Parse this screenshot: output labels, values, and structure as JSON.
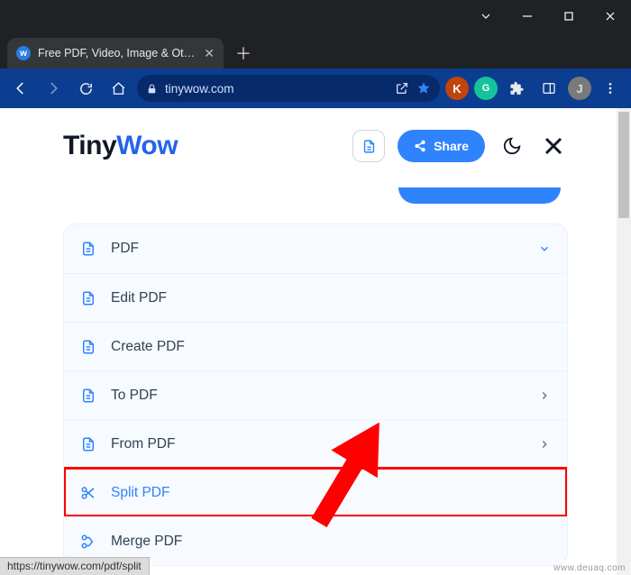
{
  "window": {
    "tab_title": "Free PDF, Video, Image & Other …"
  },
  "toolbar": {
    "url": "tinywow.com"
  },
  "header": {
    "logo_tiny": "Tiny",
    "logo_wow": "Wow",
    "share_label": "Share"
  },
  "menu": {
    "items": [
      {
        "label": "PDF",
        "icon": "file",
        "expandable": true,
        "expanded": true
      },
      {
        "label": "Edit PDF",
        "icon": "file"
      },
      {
        "label": "Create PDF",
        "icon": "file"
      },
      {
        "label": "To PDF",
        "icon": "file",
        "expandable": true
      },
      {
        "label": "From PDF",
        "icon": "file",
        "expandable": true
      },
      {
        "label": "Split PDF",
        "icon": "scissors",
        "highlighted": true
      },
      {
        "label": "Merge PDF",
        "icon": "merge"
      }
    ]
  },
  "status": {
    "url": "https://tinywow.com/pdf/split"
  },
  "watermark": "www.deuaq.com"
}
